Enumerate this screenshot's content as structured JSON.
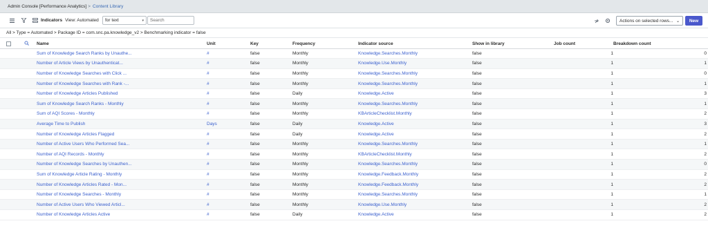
{
  "topbar": {
    "app_title": "Admin Console [Performance Analytics]",
    "separator": ">",
    "breadcrumb": "Content Library"
  },
  "toolbar": {
    "list_title": "Indicators",
    "view_label": "View: Automated",
    "search_field_select": "for text",
    "search_placeholder": "Search",
    "actions_label": "Actions on selected rows...",
    "new_label": "New"
  },
  "filter": {
    "text": "All > Type = Automated > Package ID = com.snc.pa.knowledge_v2 > Benchmarking indicator = false"
  },
  "columns": [
    "Name",
    "Unit",
    "Key",
    "Frequency",
    "Indicator source",
    "Show in library",
    "Job count",
    "Breakdown count"
  ],
  "rows": [
    {
      "name": "Sum of Knowledge Search Ranks by Unauthe...",
      "unit": "#",
      "key": "false",
      "frequency": "Monthly",
      "source": "Knowledge.Searches.Monthly",
      "show": "false",
      "job": "1",
      "breakdown": "0"
    },
    {
      "name": "Number of Article Views by Unauthenticat...",
      "unit": "#",
      "key": "false",
      "frequency": "Monthly",
      "source": "Knowledge.Use.Monthly",
      "show": "false",
      "job": "1",
      "breakdown": "1"
    },
    {
      "name": "Number of Knowledge Searches with Click ...",
      "unit": "#",
      "key": "false",
      "frequency": "Monthly",
      "source": "Knowledge.Searches.Monthly",
      "show": "false",
      "job": "1",
      "breakdown": "0"
    },
    {
      "name": "Number of Knowledge Searches with Rank -...",
      "unit": "#",
      "key": "false",
      "frequency": "Monthly",
      "source": "Knowledge.Searches.Monthly",
      "show": "false",
      "job": "1",
      "breakdown": "1"
    },
    {
      "name": "Number of Knowledge Articles Published",
      "unit": "#",
      "key": "false",
      "frequency": "Daily",
      "source": "Knowledge.Active",
      "show": "false",
      "job": "1",
      "breakdown": "3"
    },
    {
      "name": "Sum of Knowledge Search Ranks - Monthly",
      "unit": "#",
      "key": "false",
      "frequency": "Monthly",
      "source": "Knowledge.Searches.Monthly",
      "show": "false",
      "job": "1",
      "breakdown": "1"
    },
    {
      "name": "Sum of AQI Scores - Monthly",
      "unit": "#",
      "key": "false",
      "frequency": "Monthly",
      "source": "KBArticleChecklist.Monthly",
      "show": "false",
      "job": "1",
      "breakdown": "2"
    },
    {
      "name": "Average Time to Publish",
      "unit": "Days",
      "key": "false",
      "frequency": "Daily",
      "source": "Knowledge.Active",
      "show": "false",
      "job": "1",
      "breakdown": "3"
    },
    {
      "name": "Number of Knowledge Articles Flagged",
      "unit": "#",
      "key": "false",
      "frequency": "Daily",
      "source": "Knowledge.Active",
      "show": "false",
      "job": "1",
      "breakdown": "2"
    },
    {
      "name": "Number of Active Users Who Performed Sea...",
      "unit": "#",
      "key": "false",
      "frequency": "Monthly",
      "source": "Knowledge.Searches.Monthly",
      "show": "false",
      "job": "1",
      "breakdown": "1"
    },
    {
      "name": "Number of AQI Records - Monthly",
      "unit": "#",
      "key": "false",
      "frequency": "Monthly",
      "source": "KBArticleChecklist.Monthly",
      "show": "false",
      "job": "1",
      "breakdown": "2"
    },
    {
      "name": "Number of Knowledge Searches by Unauthen...",
      "unit": "#",
      "key": "false",
      "frequency": "Monthly",
      "source": "Knowledge.Searches.Monthly",
      "show": "false",
      "job": "1",
      "breakdown": "0"
    },
    {
      "name": "Sum of Knowledge Article Rating - Monthly",
      "unit": "#",
      "key": "false",
      "frequency": "Monthly",
      "source": "Knowledge.Feedback.Monthly",
      "show": "false",
      "job": "1",
      "breakdown": "2"
    },
    {
      "name": "Number of Knowledge Articles Rated - Mon...",
      "unit": "#",
      "key": "false",
      "frequency": "Monthly",
      "source": "Knowledge.Feedback.Monthly",
      "show": "false",
      "job": "1",
      "breakdown": "2"
    },
    {
      "name": "Number of Knowledge Searches - Monthly",
      "unit": "#",
      "key": "false",
      "frequency": "Monthly",
      "source": "Knowledge.Searches.Monthly",
      "show": "false",
      "job": "1",
      "breakdown": "1"
    },
    {
      "name": "Number of Active Users Who Viewed Articl...",
      "unit": "#",
      "key": "false",
      "frequency": "Monthly",
      "source": "Knowledge.Use.Monthly",
      "show": "false",
      "job": "1",
      "breakdown": "2"
    },
    {
      "name": "Number of Knowledge Articles Active",
      "unit": "#",
      "key": "false",
      "frequency": "Daily",
      "source": "Knowledge.Active",
      "show": "false",
      "job": "1",
      "breakdown": "2"
    }
  ]
}
